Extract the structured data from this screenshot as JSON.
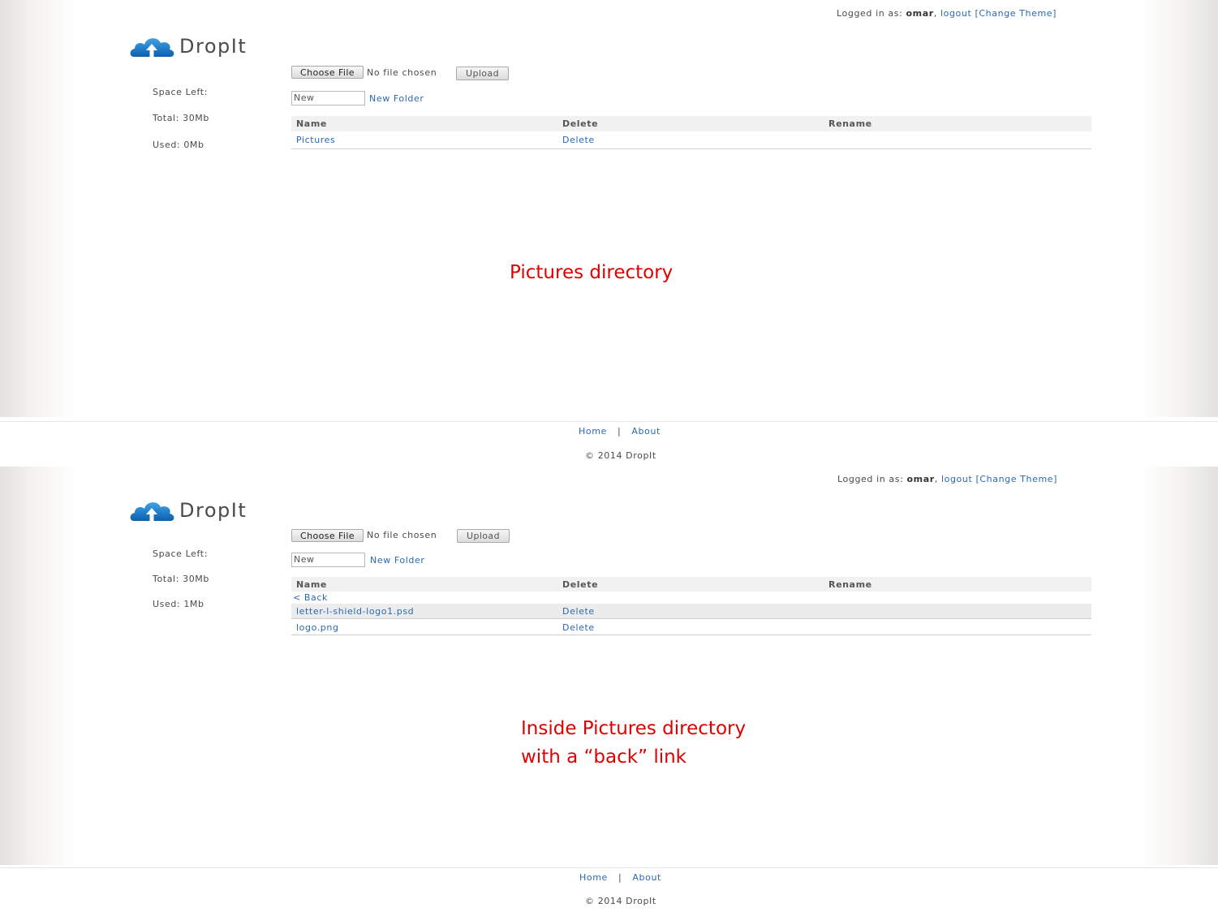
{
  "common": {
    "login_prefix": "Logged in as: ",
    "username": "omar",
    "comma": ",",
    "logout": "logout",
    "change_theme": "[Change Theme]",
    "brand": "DropIt",
    "choose_file": "Choose File",
    "no_file": "No file chosen",
    "upload": "Upload",
    "folder_input_value": "New",
    "new_folder": "New Folder",
    "col_name": "Name",
    "col_delete": "Delete",
    "col_rename": "Rename",
    "space_left": "Space Left:",
    "total": "Total: 30Mb",
    "footer_home": "Home",
    "footer_sep": "|",
    "footer_about": "About",
    "copyright": "© 2014 DropIt",
    "colors": {
      "link": "#2a68b3",
      "annotation": "#e00000"
    }
  },
  "panel1": {
    "used": "Used: 0Mb",
    "rows": [
      {
        "name": "Pictures",
        "delete": "Delete"
      }
    ],
    "annotation": "Pictures directory"
  },
  "panel2": {
    "used": "Used: 1Mb",
    "back": "< Back",
    "rows": [
      {
        "name": "letter-l-shield-logo1.psd",
        "delete": "Delete"
      },
      {
        "name": "logo.png",
        "delete": "Delete"
      }
    ],
    "annotation_line1": "Inside Pictures directory",
    "annotation_line2": "with a “back” link"
  }
}
